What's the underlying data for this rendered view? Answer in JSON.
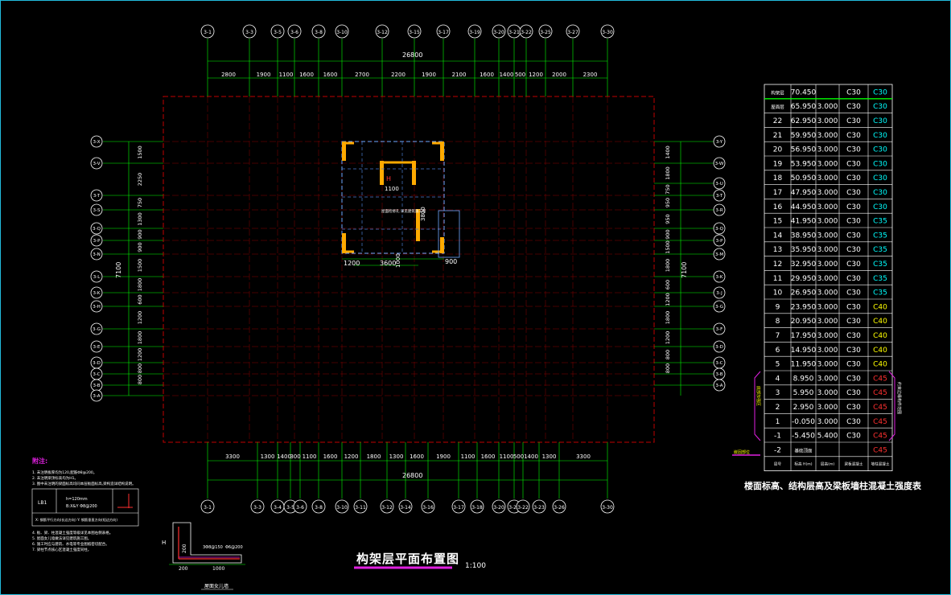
{
  "drawing": {
    "title": "构架层平面布置图",
    "scale": "1:100",
    "total_dim_top": "26800",
    "total_dim_bottom": "26800",
    "left_total": "7100",
    "right_total": "7100"
  },
  "top_axes": [
    "3-1",
    "3-3",
    "3-5",
    "3-6",
    "3-8",
    "3-10",
    "3-12",
    "3-15",
    "3-17",
    "3-19",
    "3-20",
    "3-21",
    "3-22",
    "3-25",
    "3-27",
    "3-30"
  ],
  "top_dims": [
    "2800",
    "1900",
    "1100",
    "1600",
    "1600",
    "2700",
    "2200",
    "1900",
    "2100",
    "1600",
    "1400",
    "500",
    "1200",
    "2000",
    "2300"
  ],
  "bottom_axes": [
    "3-1",
    "3-3",
    "3-4",
    "3-5",
    "3-6",
    "3-8",
    "3-10",
    "3-11",
    "3-12",
    "3-14",
    "3-16",
    "3-17",
    "3-18",
    "3-20",
    "3-21",
    "3-22",
    "3-23",
    "3-26",
    "3-30"
  ],
  "bottom_dims": [
    "3300",
    "1300",
    "1400",
    "300",
    "1100",
    "1600",
    "1200",
    "1800",
    "1300",
    "1600",
    "1900",
    "1100",
    "1600",
    "1100",
    "500",
    "1400",
    "1300",
    "3300"
  ],
  "left_axes": [
    "3-X",
    "3-V",
    "3-T",
    "3-S",
    "3-Q",
    "3-P",
    "3-N",
    "3-L",
    "3-K",
    "3-H",
    "3-G",
    "3-E",
    "3-D",
    "3-C",
    "3-B",
    "3-A"
  ],
  "left_dims": [
    "1500",
    "2250",
    "750",
    "1300",
    "900",
    "900",
    "1500",
    "1800",
    "600",
    "1200",
    "1800",
    "1200",
    "800",
    "800"
  ],
  "right_axes": [
    "3-Y",
    "3-W",
    "3-U",
    "3-T",
    "3-R",
    "3-Q",
    "3-P",
    "3-M",
    "3-K",
    "3-J",
    "3-G",
    "3-F",
    "3-D",
    "3-C",
    "3-B",
    "3-A"
  ],
  "right_dims": [
    "1400",
    "1800",
    "750",
    "950",
    "950",
    "900",
    "1500",
    "1800",
    "600",
    "1200",
    "1800",
    "1200",
    "800",
    "800"
  ],
  "core": {
    "dims": [
      "1200",
      "3600",
      "900"
    ],
    "dim_1100": "1100",
    "dim_3800": "3800",
    "dim_1000": "1000",
    "label_h": "H",
    "note": "屋面检修孔 详见建筑施工图"
  },
  "table": {
    "caption": "楼面标高、结构层高及梁板墙柱混凝土强度表",
    "header": [
      "层号",
      "标高 H(m)",
      "层高(m)",
      "梁板混凝土",
      "墙柱混凝土"
    ],
    "side_left": "嵌固部位",
    "side_note_left": "底部加强区",
    "side_note_right": "约束边缘构件范围",
    "rows": [
      [
        "构架层",
        "70.450",
        "",
        "C30",
        "C30"
      ],
      [
        "屋面层",
        "65.950",
        "3.000",
        "C30",
        "C30"
      ],
      [
        "22",
        "62.950",
        "3.000",
        "C30",
        "C30"
      ],
      [
        "21",
        "59.950",
        "3.000",
        "C30",
        "C30"
      ],
      [
        "20",
        "56.950",
        "3.000",
        "C30",
        "C30"
      ],
      [
        "19",
        "53.950",
        "3.000",
        "C30",
        "C30"
      ],
      [
        "18",
        "50.950",
        "3.000",
        "C30",
        "C30"
      ],
      [
        "17",
        "47.950",
        "3.000",
        "C30",
        "C30"
      ],
      [
        "16",
        "44.950",
        "3.000",
        "C30",
        "C30"
      ],
      [
        "15",
        "41.950",
        "3.000",
        "C30",
        "C35"
      ],
      [
        "14",
        "38.950",
        "3.000",
        "C30",
        "C35"
      ],
      [
        "13",
        "35.950",
        "3.000",
        "C30",
        "C35"
      ],
      [
        "12",
        "32.950",
        "3.000",
        "C30",
        "C35"
      ],
      [
        "11",
        "29.950",
        "3.000",
        "C30",
        "C35"
      ],
      [
        "10",
        "26.950",
        "3.000",
        "C30",
        "C35"
      ],
      [
        "9",
        "23.950",
        "3.000",
        "C30",
        "C40"
      ],
      [
        "8",
        "20.950",
        "3.000",
        "C30",
        "C40"
      ],
      [
        "7",
        "17.950",
        "3.000",
        "C30",
        "C40"
      ],
      [
        "6",
        "14.950",
        "3.000",
        "C30",
        "C40"
      ],
      [
        "5",
        "11.950",
        "3.000",
        "C30",
        "C40"
      ],
      [
        "4",
        "8.950",
        "3.000",
        "C30",
        "C45"
      ],
      [
        "3",
        "5.950",
        "3.000",
        "C30",
        "C45"
      ],
      [
        "2",
        "2.950",
        "3.000",
        "C30",
        "C45"
      ],
      [
        "1",
        "-0.050",
        "3.000",
        "C30",
        "C45"
      ],
      [
        "-1",
        "-5.450",
        "5.400",
        "C30",
        "C45"
      ],
      [
        "-2",
        "基础顶面",
        "",
        "",
        "C45"
      ]
    ],
    "grade_colors": {
      "C30": "#00ffff",
      "C35": "#00ffff",
      "C40": "#ffff00",
      "C45": "#ff3030"
    }
  },
  "notes": {
    "heading": "附注:",
    "lines": [
      "1. 未注明板厚均为120,配筋Φ8@200。",
      "2. 未注明梁顶标高均为H1。",
      "3. 图中未注明的梁面标高均同本层板面标高,梁构造详结构说明。"
    ],
    "legend_code": "LB1",
    "legend_h": "h=120mm",
    "legend_b": "B:X&Y Φ8@200",
    "legend_axes": "X: 钢筋平行方向(长边方向)  Y: 钢筋垂直方向(短边方向)",
    "lines2": [
      "4. 板、梁、柱混凝土强度等级详见本图右侧表格。",
      "5. 屋面女儿墙做法详见建筑施工图。",
      "6. 施工时应与建筑、水电等专业图纸密切配合。",
      "7. 梁柱节点核心区混凝土强度同柱。"
    ]
  },
  "detail": {
    "label_h": "H",
    "dims_bottom": [
      "200",
      "1000"
    ],
    "dim_200": "200",
    "rebar": "3Φ8@150",
    "rebar2": "Φ6@200",
    "caption": "屋面女儿墙"
  }
}
